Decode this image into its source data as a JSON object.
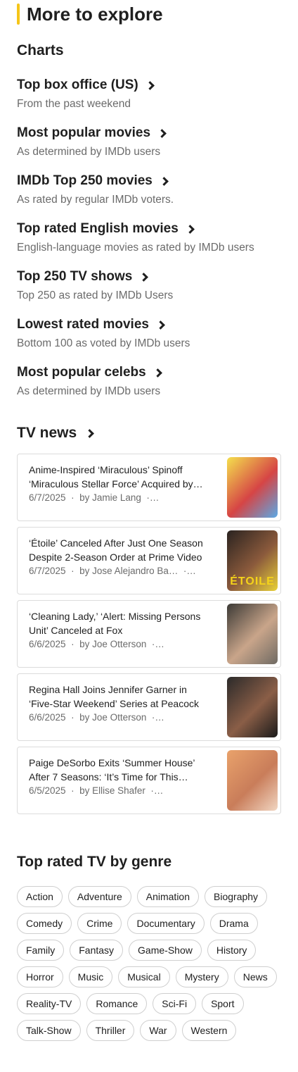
{
  "section_title": "More to explore",
  "charts": {
    "heading": "Charts",
    "items": [
      {
        "title": "Top box office (US)",
        "subtitle": "From the past weekend"
      },
      {
        "title": "Most popular movies",
        "subtitle": "As determined by IMDb users"
      },
      {
        "title": "IMDb Top 250 movies",
        "subtitle": "As rated by regular IMDb voters."
      },
      {
        "title": "Top rated English movies",
        "subtitle": "English-language movies as rated by IMDb users"
      },
      {
        "title": "Top 250 TV shows",
        "subtitle": "Top 250 as rated by IMDb Users"
      },
      {
        "title": "Lowest rated movies",
        "subtitle": "Bottom 100 as voted by IMDb users"
      },
      {
        "title": "Most popular celebs",
        "subtitle": "As determined by IMDb users"
      }
    ]
  },
  "tv_news": {
    "heading": "TV news",
    "items": [
      {
        "headline": "Anime-Inspired ‘Miraculous’ Spinoff ‘Miraculous Stellar Force’ Acquired by…",
        "date": "6/7/2025",
        "author": "by Jamie Lang",
        "thumb_colors": [
          "#f4e04d",
          "#d64545",
          "#5aa9e6"
        ]
      },
      {
        "headline": "‘Étoile’ Canceled After Just One Season Despite 2-Season Order at Prime Video",
        "date": "6/7/2025",
        "author": "by Jose Alejandro Ba…",
        "thumb_colors": [
          "#2a2320",
          "#8b5a3c",
          "#e8d13a"
        ],
        "thumb_text": "ÉTOILE"
      },
      {
        "headline": "‘Cleaning Lady,’ ‘Alert: Missing Persons Unit’ Canceled at Fox",
        "date": "6/6/2025",
        "author": "by Joe Otterson",
        "thumb_colors": [
          "#3c3a36",
          "#c9a58a",
          "#6f6a63"
        ]
      },
      {
        "headline": "Regina Hall Joins Jennifer Garner in ‘Five-Star Weekend’ Series at Peacock",
        "date": "6/6/2025",
        "author": "by Joe Otterson",
        "thumb_colors": [
          "#2b2a2a",
          "#8a5e47",
          "#1a1a1a"
        ]
      },
      {
        "headline": "Paige DeSorbo Exits ‘Summer House’ After 7 Seasons: ‘It’s Time for This…",
        "date": "6/5/2025",
        "author": "by Ellise Shafer",
        "thumb_colors": [
          "#e9a26b",
          "#c97d5a",
          "#f1d6c2"
        ]
      }
    ]
  },
  "genres": {
    "heading": "Top rated TV by genre",
    "items": [
      "Action",
      "Adventure",
      "Animation",
      "Biography",
      "Comedy",
      "Crime",
      "Documentary",
      "Drama",
      "Family",
      "Fantasy",
      "Game-Show",
      "History",
      "Horror",
      "Music",
      "Musical",
      "Mystery",
      "News",
      "Reality-TV",
      "Romance",
      "Sci-Fi",
      "Sport",
      "Talk-Show",
      "Thriller",
      "War",
      "Western"
    ]
  },
  "colors": {
    "accent": "#f5c518",
    "text": "#1f1f1f",
    "muted": "#6b6b6b",
    "border": "#dcdcdc"
  }
}
